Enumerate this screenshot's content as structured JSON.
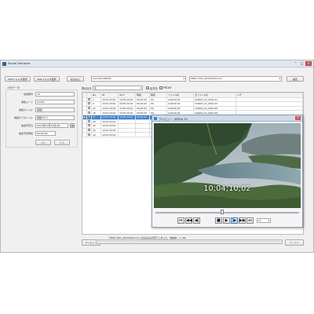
{
  "window": {
    "title": "Partial Retriever"
  },
  "toolbar": {
    "btn1": "MXFフォルダ選択",
    "btn2": "XMLフォルダ選択",
    "btn3": "読み込む",
    "folder_path": "/xxx/20130630/",
    "file_select": "PDW_T101_20131024.xml",
    "settings_btn": "設定"
  },
  "metadata": {
    "section": "メタデータ",
    "fields": [
      {
        "label": "収録番号",
        "value": "70"
      },
      {
        "label": "番組コード",
        "value": "12345"
      },
      {
        "label": "番組タイトル",
        "value": "番組1"
      },
      {
        "label": "番組サブタイトル",
        "value": "番組1サブ"
      }
    ],
    "date_label": "放送予定日",
    "date_value": "2013年10月31日(木)",
    "duration_label": "放送予定時間",
    "duration_value": "00:05:00",
    "btn_apply": "適用",
    "btn_cancel": "取消"
  },
  "filter": {
    "label": "表示区分",
    "select_value": "全",
    "check1": "全方向",
    "check2": "PROXY"
  },
  "table": {
    "headers": [
      "",
      "",
      "No.",
      "IN",
      "OUT",
      "時間",
      "種別",
      "ファイル名",
      "元ファイル名",
      "メモ"
    ],
    "rows": [
      {
        "no": "1",
        "in": "10:01:20:02",
        "out": "10:05:20:02",
        "dur": "00:04:00",
        "kind": "PG",
        "file": "CL0010-01",
        "src": "CS0001_01_0001-01",
        "memo": ""
      },
      {
        "no": "6",
        "in": "10:01:20:02",
        "out": "10:05:20:02",
        "dur": "00:04:00",
        "kind": "PG",
        "file": "CL0010-03",
        "src": "CS0001_01_0001-03",
        "memo": ""
      },
      {
        "no": "12",
        "in": "10:01:20:02",
        "out": "10:05:20:02",
        "dur": "00:04:00",
        "kind": "PG",
        "file": "CL0010-06",
        "src": "CS0001_01_0001-06",
        "memo": ""
      },
      {
        "no": "16",
        "in": "10:01:20:02",
        "out": "10:05:20:02",
        "dur": "00:04:00",
        "kind": "PG",
        "file": "CL0010-09",
        "src": "CS0001_01_0001-09",
        "memo": ""
      },
      {
        "no": "17",
        "in": "10:01:20:02",
        "out": "10:05:20:02",
        "dur": "00:04:00",
        "kind": "",
        "file": "",
        "src": "",
        "memo": ""
      },
      {
        "no": "28",
        "in": "10:01:20:02",
        "out": "",
        "dur": "",
        "kind": "",
        "file": "",
        "src": "",
        "memo": ""
      },
      {
        "no": "32",
        "in": "10:01:20:02",
        "out": "",
        "dur": "",
        "kind": "",
        "file": "",
        "src": "",
        "memo": ""
      },
      {
        "no": "43",
        "in": "10:01:20:02",
        "out": "",
        "dur": "",
        "kind": "",
        "file": "",
        "src": "",
        "memo": ""
      },
      {
        "no": "44",
        "in": "10:01:20:02",
        "out": "",
        "dur": "",
        "kind": "",
        "file": "",
        "src": "",
        "memo": ""
      }
    ]
  },
  "preview": {
    "title": "プレビュー - 8Z01h-10",
    "timecode": "10;04;10;02",
    "speed": "1x"
  },
  "bottom": {
    "preview_btn": "プレビュー",
    "status": "「PDW_T101_20131024.xml」の読み込みが完了しました。(格納中：1 / 99)",
    "progress": 0.0,
    "disabled_btn": "部分取得"
  },
  "colors": {
    "accent": "#3a86d6",
    "title_bar": "#dfe6ee"
  }
}
